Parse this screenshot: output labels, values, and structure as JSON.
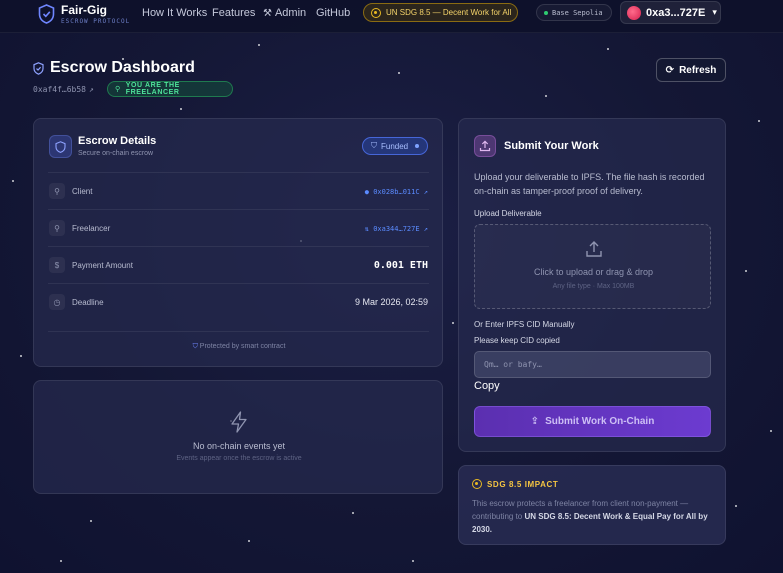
{
  "nav": {
    "brand": "Fair-Gig",
    "brand_sub": "ESCROW PROTOCOL",
    "links": [
      "How It Works",
      "Features",
      "Admin",
      "GitHub"
    ],
    "sdg_pill": "UN SDG 8.5 — Decent Work for All",
    "network": "Base Sepolia",
    "wallet": "0xa3...727E"
  },
  "header": {
    "title": "Escrow Dashboard",
    "contract_address": "0xaf4f…6b58",
    "role_badge": "YOU ARE THE FREELANCER",
    "refresh_label": "Refresh"
  },
  "details": {
    "title": "Escrow Details",
    "subtitle": "Secure on-chain escrow",
    "status": "Funded",
    "rows": [
      {
        "label": "Client",
        "value": "0x028b…011C"
      },
      {
        "label": "Freelancer",
        "value": "0xa344…727E"
      },
      {
        "label": "Payment Amount",
        "value": "0.001 ETH"
      },
      {
        "label": "Deadline",
        "value": "9 Mar 2026, 02:59"
      }
    ],
    "footer": "Protected by smart contract"
  },
  "events": {
    "title": "No on-chain events yet",
    "subtitle": "Events appear once the escrow is active"
  },
  "submit": {
    "title": "Submit Your Work",
    "description": "Upload your deliverable to IPFS. The file hash is recorded on-chain as tamper-proof proof of delivery.",
    "upload_label": "Upload Deliverable",
    "dropzone_main": "Click to upload or drag & drop",
    "dropzone_sub": "Any file type · Max 100MB",
    "cid_label": "Or Enter IPFS CID Manually",
    "cid_hint": "Please keep CID copied",
    "cid_placeholder": "Qm… or bafy…",
    "copy_label": "Copy",
    "submit_label": "Submit Work On-Chain"
  },
  "impact": {
    "title": "SDG 8.5 IMPACT",
    "text_pre": "This escrow protects a freelancer from client non-payment — contributing to ",
    "text_bold": "UN SDG 8.5: Decent Work & Equal Pay for All by 2030."
  },
  "colors": {
    "accent": "#6c3bd0",
    "link": "#5b8bff",
    "success": "#4ee29a",
    "gold": "#f5c542"
  }
}
